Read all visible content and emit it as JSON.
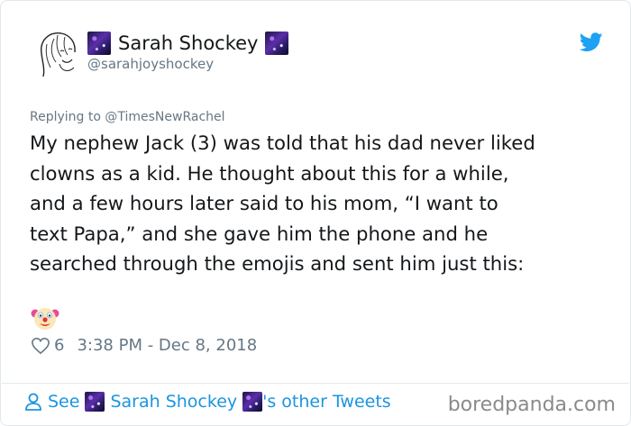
{
  "tweet": {
    "display_name": "Sarah Shockey",
    "handle": "@sarahjoyshockey",
    "replying_to": "Replying to @TimesNewRachel",
    "text": "My nephew Jack (3) was told that his dad never liked\nclowns as a kid. He thought about this for a while,\nand a few hours later said to his mom, “I want to\ntext Papa,” and she gave him the phone and he\nsearched through the emojis and sent him just this:",
    "likes": "6",
    "timestamp": "3:38 PM - Dec 8, 2018"
  },
  "footer": {
    "see_label": "See",
    "name": "Sarah Shockey",
    "suffix": "'s other Tweets"
  },
  "watermark": "boredpanda.com",
  "icons": {
    "brand": "twitter-bird-icon",
    "name_emoji": "milky-way-icon",
    "tweet_emoji": "clown-face-icon",
    "like": "heart-icon",
    "footer": "person-icon"
  },
  "colors": {
    "link": "#1b95e0",
    "muted": "#657786",
    "text": "#14171a",
    "border": "#e1e8ed"
  }
}
